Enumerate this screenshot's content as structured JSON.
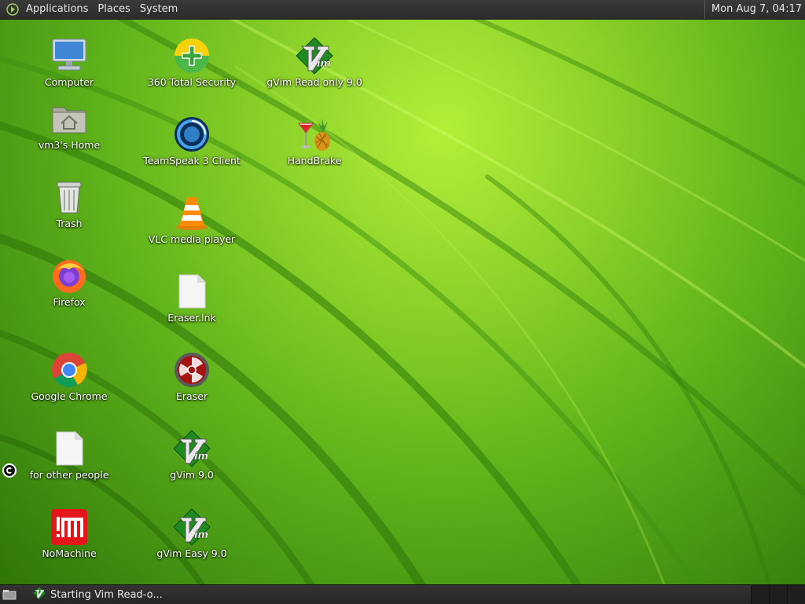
{
  "top_panel": {
    "menus": [
      "Applications",
      "Places",
      "System"
    ],
    "clock": "Mon Aug  7, 04:17"
  },
  "desktop_icons": {
    "computer": "Computer",
    "home": "vm3's Home",
    "trash": "Trash",
    "firefox": "Firefox",
    "chrome": "Google Chrome",
    "other_people": "for other people",
    "nomachine": "NoMachine",
    "security360": "360 Total Security",
    "teamspeak": "TeamSpeak 3 Client",
    "vlc": "VLC media player",
    "eraser_lnk": "Eraser.lnk",
    "eraser": "Eraser",
    "gvim": "gVim 9.0",
    "gvim_easy": "gVim Easy 9.0",
    "gvim_readonly": "gVim Read only 9.0",
    "handbrake": "HandBrake"
  },
  "taskbar": {
    "task_label": "Starting Vim Read-o..."
  },
  "colors": {
    "panel": "#2b2b2b",
    "wallpaper": "#5eb21a"
  }
}
